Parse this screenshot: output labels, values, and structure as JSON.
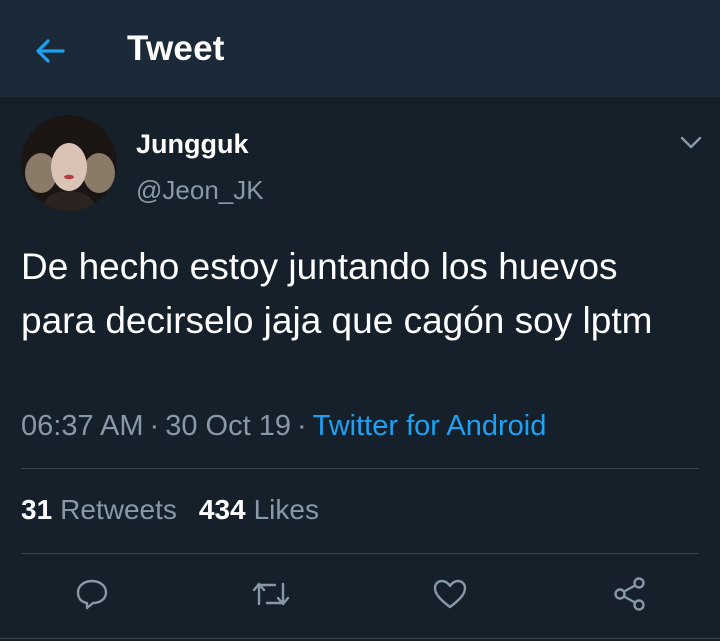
{
  "header": {
    "title": "Tweet",
    "back_icon": "arrow-left-icon"
  },
  "author": {
    "name": "Jungguk",
    "handle": "@Jeon_JK",
    "avatar_icon": "avatar"
  },
  "tweet": {
    "text": "De hecho estoy juntando los huevos para decirselo jaja que cagón soy lptm",
    "time": "06:37 AM",
    "date": "30 Oct 19",
    "separator": "·",
    "source": "Twitter for Android"
  },
  "stats": {
    "retweets_count": "31",
    "retweets_label": "Retweets",
    "likes_count": "434",
    "likes_label": "Likes"
  },
  "actions": [
    "reply-icon",
    "retweet-icon",
    "like-icon",
    "share-icon"
  ],
  "colors": {
    "background": "#15202b",
    "header_background": "#1c2938",
    "accent": "#1da1f2",
    "secondary_text": "#8899a6",
    "divider": "#38444d"
  }
}
